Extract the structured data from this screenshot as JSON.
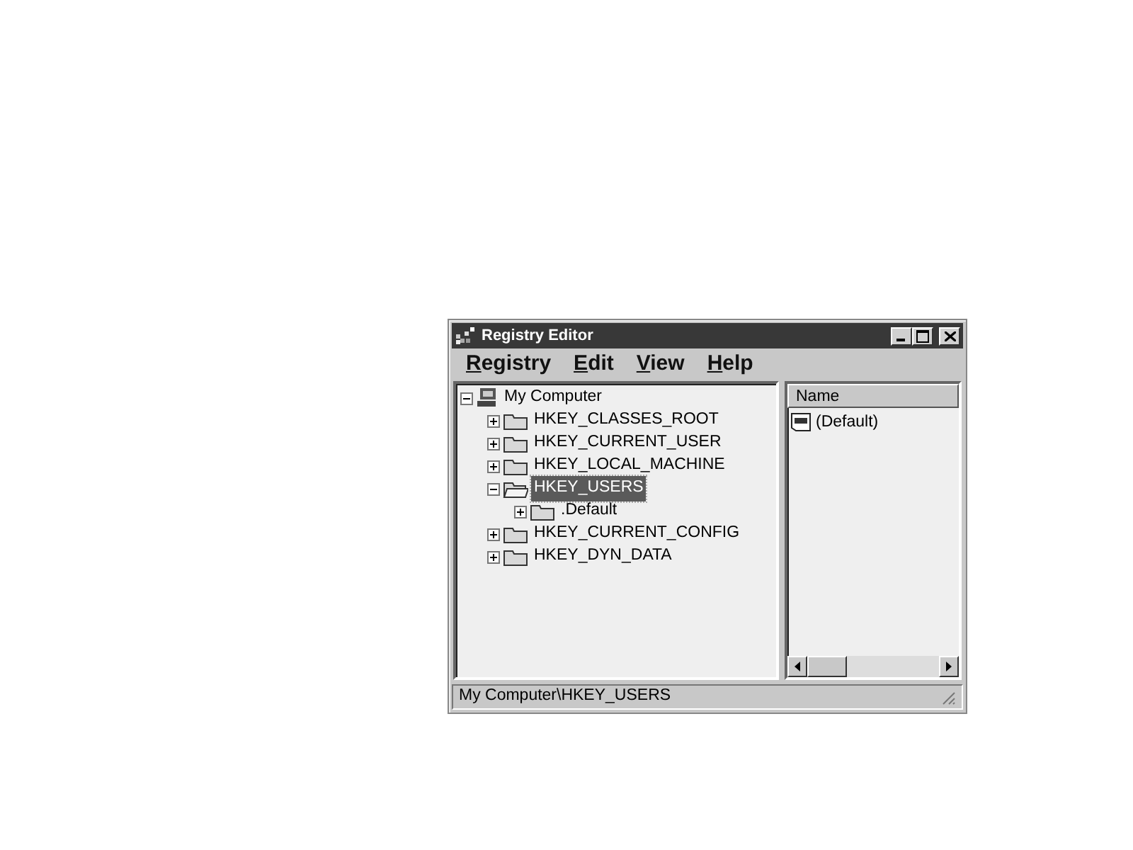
{
  "window": {
    "title": "Registry Editor"
  },
  "menu": [
    "Registry",
    "Edit",
    "View",
    "Help"
  ],
  "tree": [
    {
      "label": "My Computer",
      "kind": "computer",
      "expanded": true,
      "selected": false,
      "children": [
        {
          "label": "HKEY_CLASSES_ROOT",
          "kind": "folder",
          "expanded": false,
          "selected": false
        },
        {
          "label": "HKEY_CURRENT_USER",
          "kind": "folder",
          "expanded": false,
          "selected": false
        },
        {
          "label": "HKEY_LOCAL_MACHINE",
          "kind": "folder",
          "expanded": false,
          "selected": false
        },
        {
          "label": "HKEY_USERS",
          "kind": "folder",
          "expanded": true,
          "selected": true,
          "children": [
            {
              "label": ".Default",
              "kind": "folder",
              "expanded": false,
              "selected": false
            }
          ]
        },
        {
          "label": "HKEY_CURRENT_CONFIG",
          "kind": "folder",
          "expanded": false,
          "selected": false
        },
        {
          "label": "HKEY_DYN_DATA",
          "kind": "folder",
          "expanded": false,
          "selected": false
        }
      ]
    }
  ],
  "list": {
    "columns": [
      "Name"
    ],
    "rows": [
      {
        "name": "(Default)"
      }
    ]
  },
  "status_bar": "My Computer\\HKEY_USERS"
}
